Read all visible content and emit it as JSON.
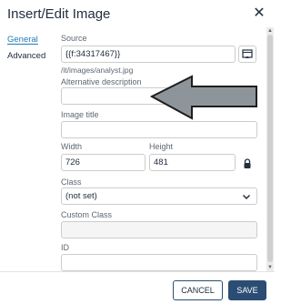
{
  "dialog": {
    "title": "Insert/Edit Image",
    "close_icon": "close-icon"
  },
  "tabs": [
    {
      "label": "General",
      "active": true
    },
    {
      "label": "Advanced",
      "active": false
    }
  ],
  "form": {
    "source_label": "Source",
    "source_value": "{{f:34317467}}",
    "source_subtext": "/it/images/analyst.jpg",
    "browse_icon": "browse-icon",
    "alt_label": "Alternative description",
    "alt_value": "",
    "image_title_label": "Image title",
    "image_title_value": "",
    "width_label": "Width",
    "width_value": "726",
    "height_label": "Height",
    "height_value": "481",
    "lock_icon": "lock-icon",
    "class_label": "Class",
    "class_value": "(not set)",
    "custom_class_label": "Custom Class",
    "custom_class_value": "",
    "id_label": "ID",
    "id_value": ""
  },
  "footer": {
    "cancel_label": "CANCEL",
    "save_label": "SAVE"
  },
  "colors": {
    "accent": "#207ab7",
    "primary_button": "#2b4d74",
    "arrow_fill": "#8e959a"
  }
}
